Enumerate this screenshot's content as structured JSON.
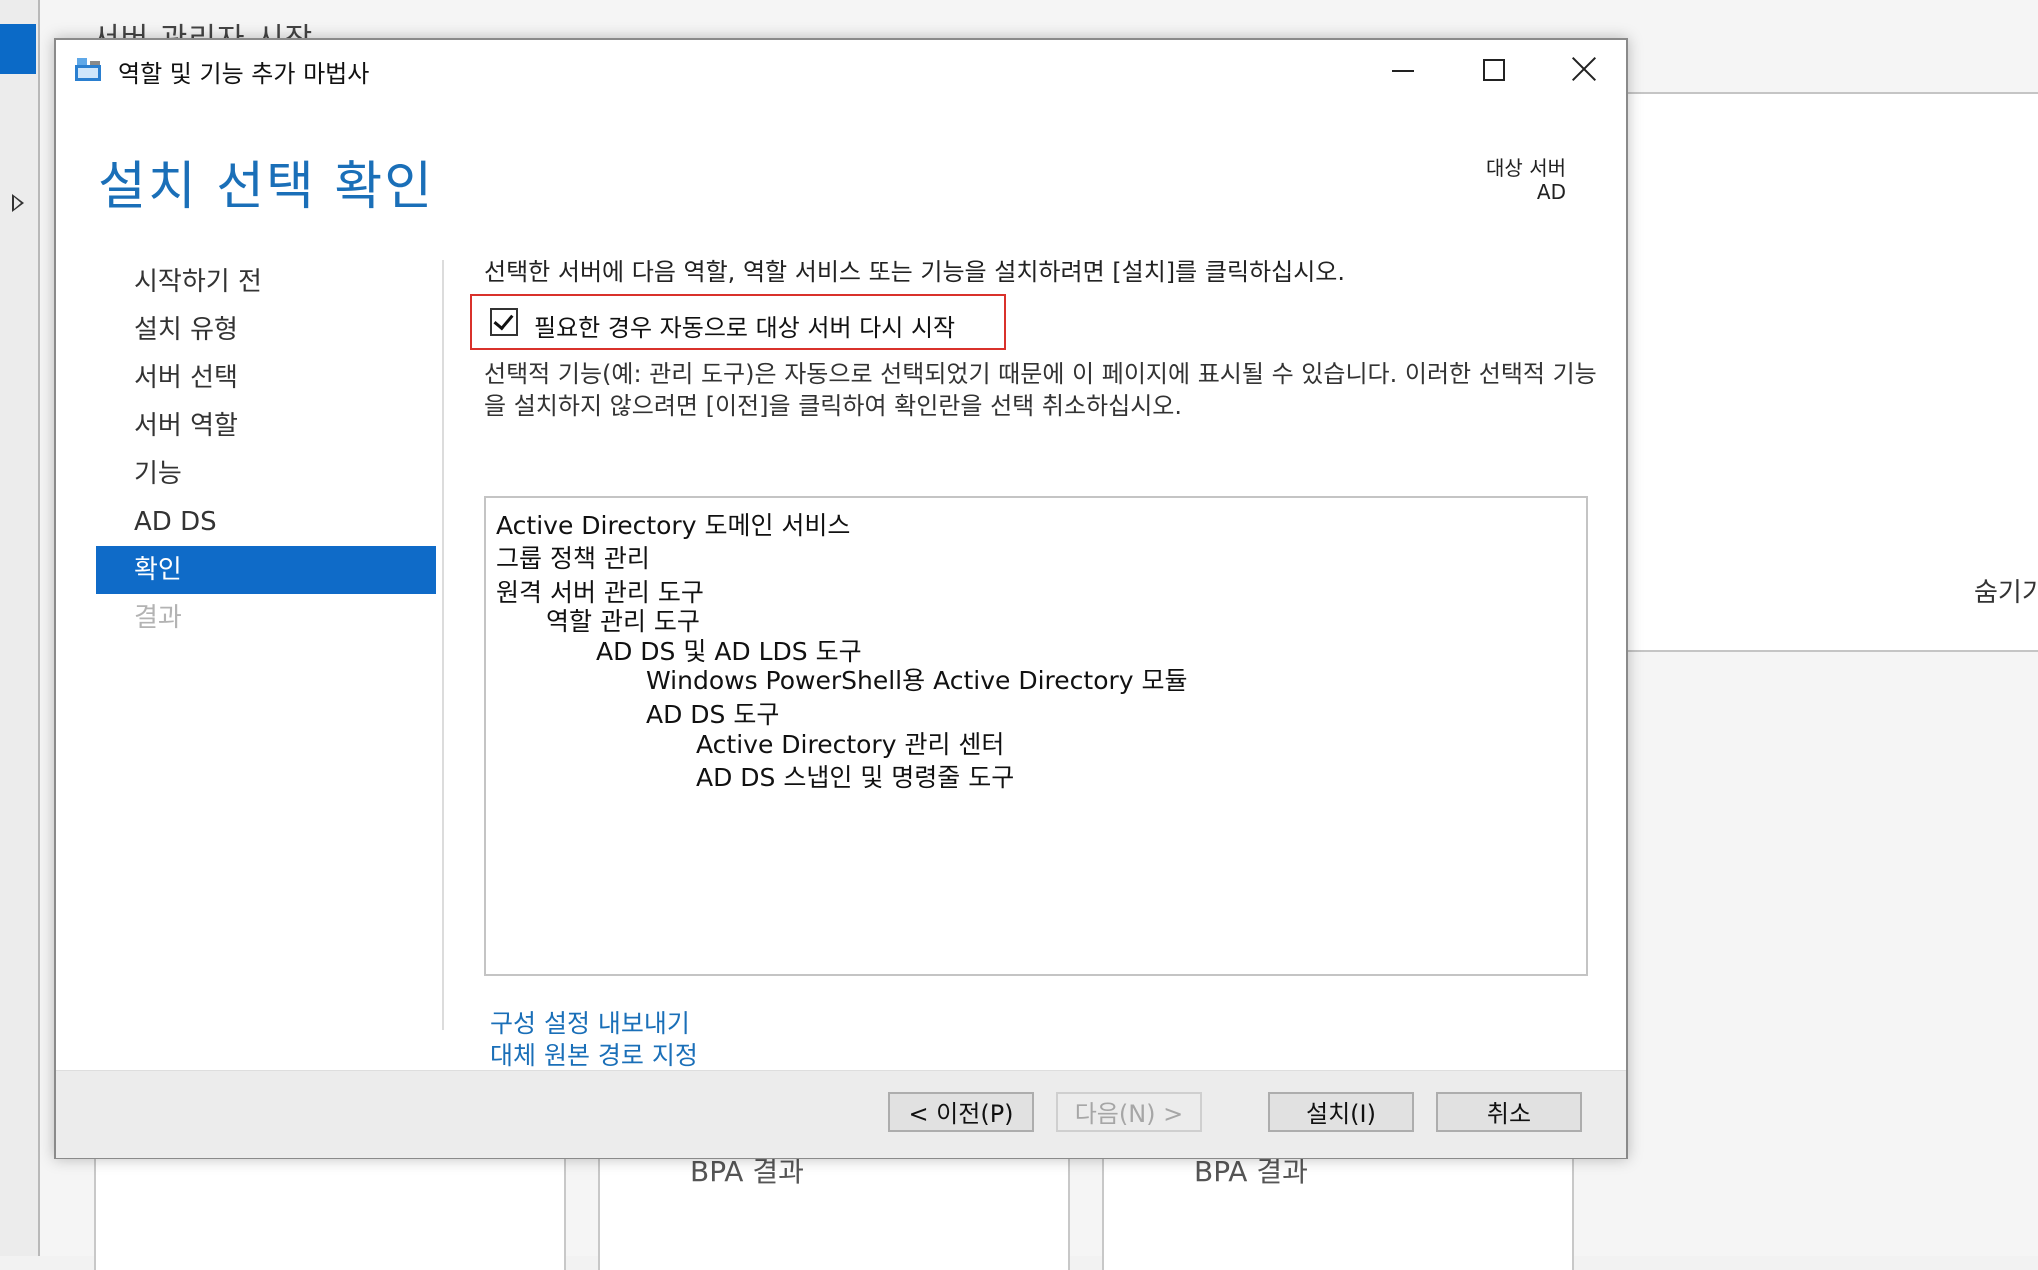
{
  "background": {
    "header_text": "서버 관리자 시작",
    "hide_label": "숨기기",
    "tiles": [
      "BPA 결과",
      "BPA 결과"
    ]
  },
  "window": {
    "title": "역할 및 기능 추가 마법사",
    "buttons": {
      "minimize": "minimize",
      "maximize": "maximize",
      "close": "close"
    }
  },
  "page": {
    "title": "설치 선택 확인",
    "target_label": "대상 서버",
    "target_value": "AD"
  },
  "nav": {
    "items": [
      {
        "label": "시작하기 전",
        "state": "normal"
      },
      {
        "label": "설치 유형",
        "state": "normal"
      },
      {
        "label": "서버 선택",
        "state": "normal"
      },
      {
        "label": "서버 역할",
        "state": "normal"
      },
      {
        "label": "기능",
        "state": "normal"
      },
      {
        "label": "AD DS",
        "state": "normal"
      },
      {
        "label": "확인",
        "state": "active"
      },
      {
        "label": "결과",
        "state": "disabled"
      }
    ]
  },
  "content": {
    "instruction": "선택한 서버에 다음 역할, 역할 서비스 또는 기능을 설치하려면 [설치]를 클릭하십시오.",
    "restart_checkbox": {
      "label": "필요한 경우 자동으로 대상 서버 다시 시작",
      "checked": true
    },
    "note": "선택적 기능(예: 관리 도구)은 자동으로 선택되었기 때문에 이 페이지에 표시될 수 있습니다. 이러한 선택적 기능을 설치하지 않으려면 [이전]을 클릭하여 확인란을 선택 취소하십시오.",
    "features": [
      {
        "label": "Active Directory 도메인 서비스",
        "level": 0
      },
      {
        "label": "그룹 정책 관리",
        "level": 0
      },
      {
        "label": "원격 서버 관리 도구",
        "level": 0
      },
      {
        "label": "역할 관리 도구",
        "level": 1
      },
      {
        "label": "AD DS 및 AD LDS 도구",
        "level": 2
      },
      {
        "label": "Windows PowerShell용 Active Directory 모듈",
        "level": 3
      },
      {
        "label": "AD DS 도구",
        "level": 3
      },
      {
        "label": "Active Directory 관리 센터",
        "level": 4
      },
      {
        "label": "AD DS 스냅인 및 명령줄 도구",
        "level": 4
      }
    ],
    "links": {
      "export": "구성 설정 내보내기",
      "alternate_source": "대체 원본 경로 지정"
    }
  },
  "footer": {
    "prev": "< 이전(P)",
    "next": "다음(N) >",
    "install": "설치(I)",
    "cancel": "취소"
  },
  "colors": {
    "accent": "#0f6bc8",
    "title_blue": "#1a6fb8",
    "highlight_border": "#d9312b"
  }
}
